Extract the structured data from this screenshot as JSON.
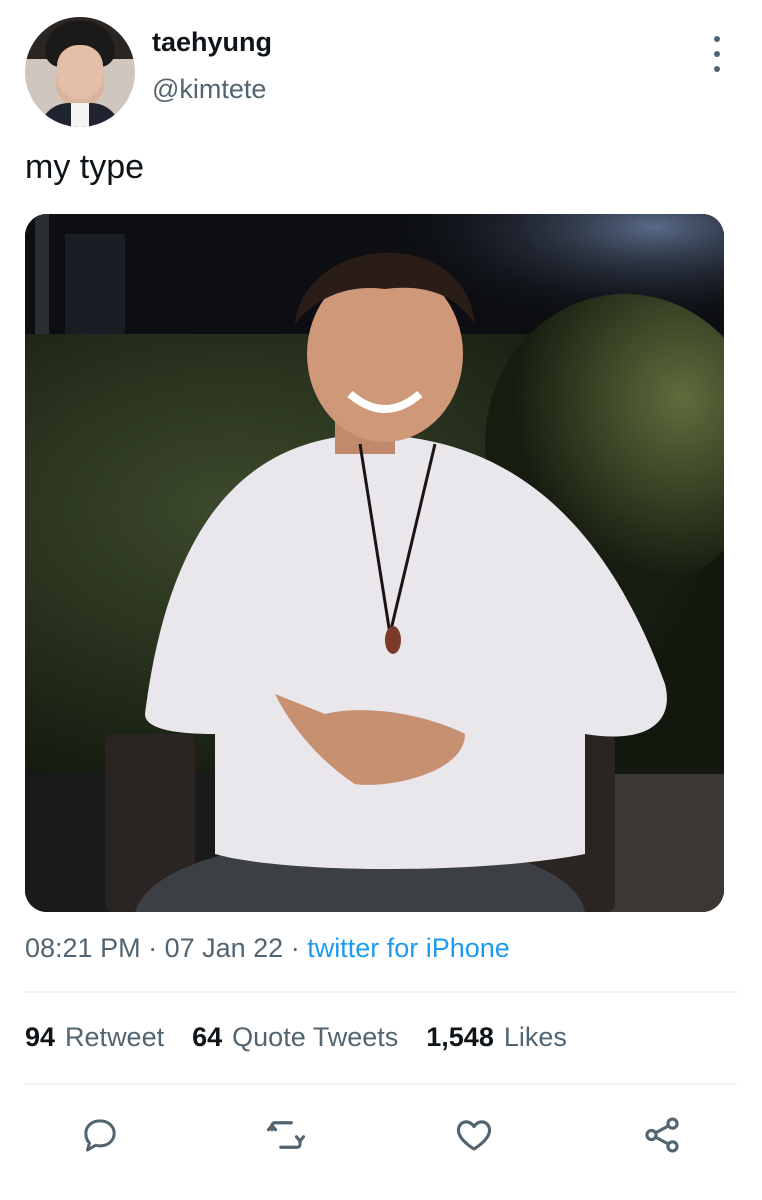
{
  "author": {
    "display_name": "taehyung",
    "handle": "@kimtete"
  },
  "tweet": {
    "text": "my type",
    "time": "08:21 PM",
    "sep1": " · ",
    "date": "07 Jan 22",
    "sep2": " · ",
    "source": "twitter for iPhone"
  },
  "stats": {
    "retweets_count": "94",
    "retweets_label": "Retweet",
    "quotes_count": "64",
    "quotes_label": "Quote Tweets",
    "likes_count": "1,548",
    "likes_label": "Likes"
  },
  "icons": {
    "more": "more-vertical-icon",
    "reply": "reply-icon",
    "retweet": "retweet-icon",
    "like": "heart-icon",
    "share": "share-icon"
  },
  "colors": {
    "text": "#0f1419",
    "secondary": "#536471",
    "link": "#1d9bf0",
    "divider": "#eff3f4"
  }
}
